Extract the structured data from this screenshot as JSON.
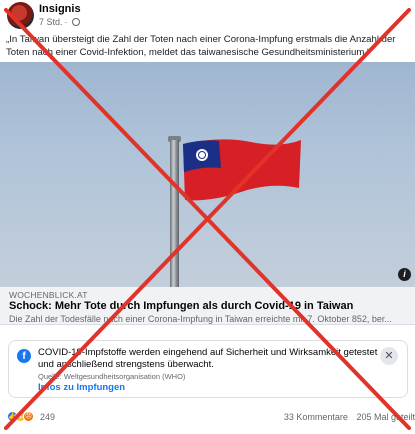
{
  "post": {
    "page_name": "Insignis",
    "time": "7 Std.",
    "separator": "·",
    "caption": "„In Taiwan übersteigt die Zahl der Toten nach einer Corona-Impfung erstmals die Anzahl der Toten nach einer Covid-Infektion, meldet das taiwanesische Gesundheitsministerium.“"
  },
  "link_preview": {
    "domain": "WOCHENBLICK.AT",
    "title": "Schock: Mehr Tote durch Impfungen als durch Covid-19 in Taiwan",
    "description": "Die Zahl der Todesfälle nach einer Corona-Impfung in Taiwan erreichte mit 7. Oktober 852, ber..."
  },
  "covid_notice": {
    "text": "COVID-19-Impfstoffe werden eingehend auf Sicherheit und Wirksamkeit getestet und anschließend strengstens überwacht.",
    "source": "Quelle: Weltgesundheitsorganisation (WHO)",
    "link": "Infos zu Impfungen",
    "close_symbol": "✕"
  },
  "footer": {
    "reaction_count": "249",
    "comments": "33 Kommentare",
    "shares": "205 Mal geteilt"
  },
  "icons": {
    "info": "i",
    "facebook": "f",
    "like": "👍",
    "wow": "😮",
    "angry": "😠"
  },
  "colors": {
    "cross": "#e0332a",
    "accent": "#1877f2",
    "flag_red": "#d71f26",
    "flag_blue": "#1b2f87"
  }
}
